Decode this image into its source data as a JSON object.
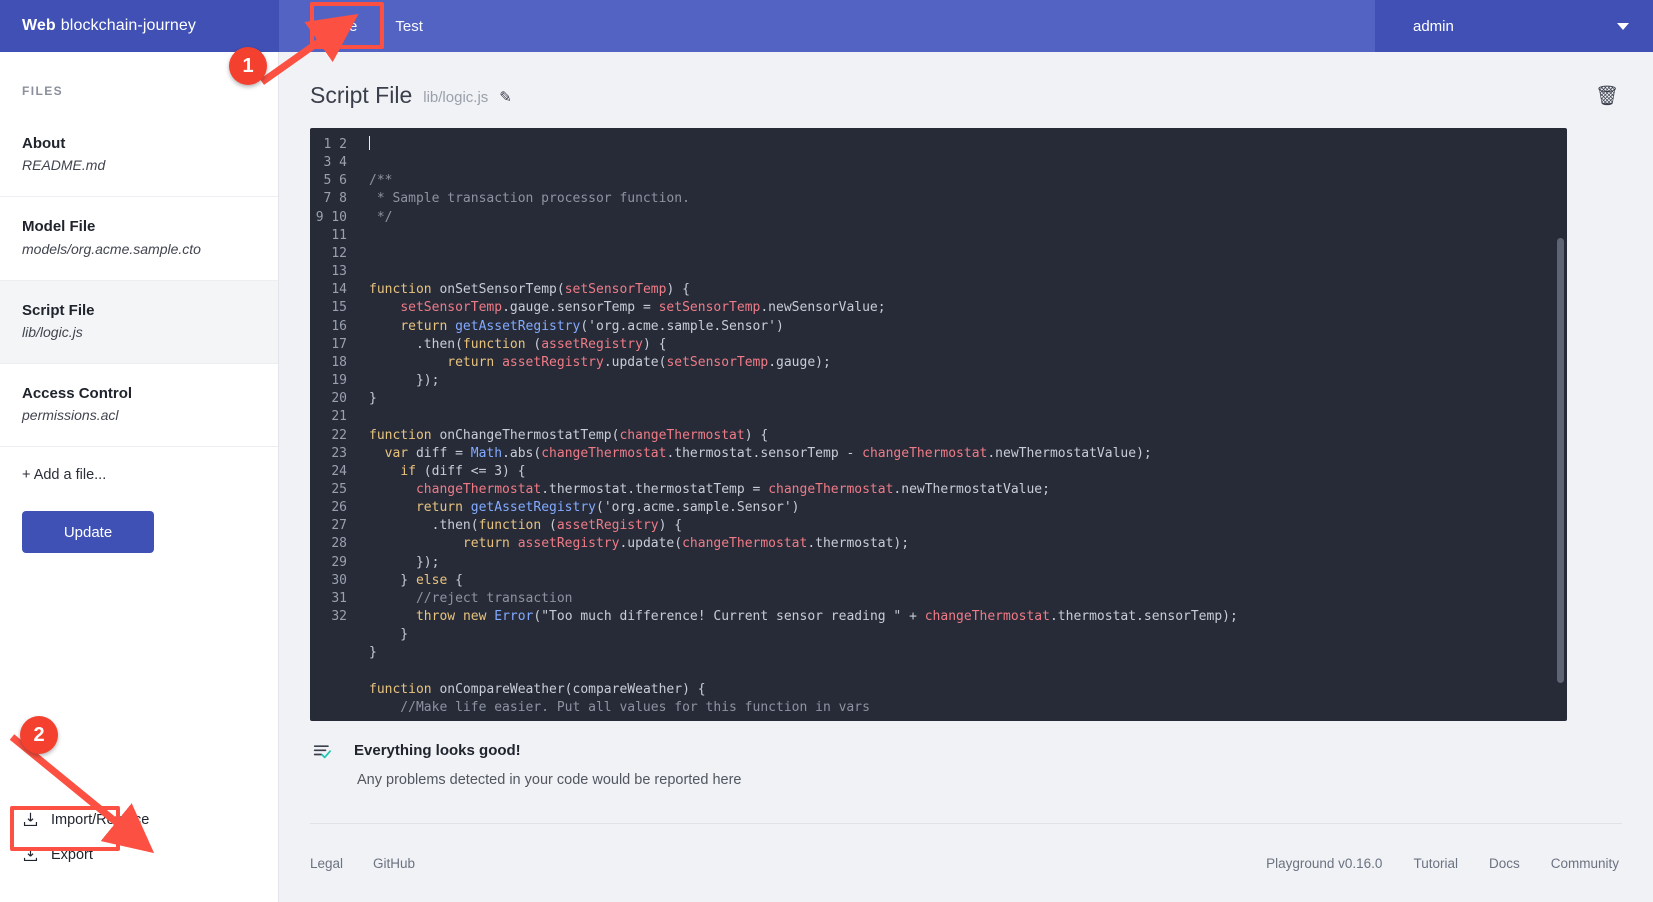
{
  "header": {
    "brand_bold": "Web",
    "brand_rest": "blockchain-journey",
    "tabs": [
      {
        "label": "Define",
        "active": true
      },
      {
        "label": "Test",
        "active": false
      }
    ],
    "user": "admin",
    "caret_icon": "chevron-down-icon",
    "bg_color": "#4050b5",
    "nav_bg_color": "#5263c3"
  },
  "sidebar": {
    "section_label": "FILES",
    "files": [
      {
        "title": "About",
        "path": "README.md",
        "selected": false
      },
      {
        "title": "Model File",
        "path": "models/org.acme.sample.cto",
        "selected": false
      },
      {
        "title": "Script File",
        "path": "lib/logic.js",
        "selected": true
      },
      {
        "title": "Access Control",
        "path": "permissions.acl",
        "selected": false
      }
    ],
    "add_file_label": "+ Add a file...",
    "update_label": "Update",
    "actions": [
      {
        "label": "Import/Replace",
        "icon": "import-icon"
      },
      {
        "label": "Export",
        "icon": "export-icon"
      }
    ]
  },
  "editor": {
    "title": "Script File",
    "file": "lib/logic.js",
    "edit_icon": "pencil-icon",
    "delete_icon": "trash-icon",
    "code_lines": [
      "",
      "",
      "/**",
      " * Sample transaction processor function.",
      " */",
      "",
      "",
      "",
      "function onSetSensorTemp(setSensorTemp) {",
      "    setSensorTemp.gauge.sensorTemp = setSensorTemp.newSensorValue;",
      "    return getAssetRegistry('org.acme.sample.Sensor')",
      "      .then(function (assetRegistry) {",
      "          return assetRegistry.update(setSensorTemp.gauge);",
      "      });",
      "}",
      "",
      "function onChangeThermostatTemp(changeThermostat) {",
      "  var diff = Math.abs(changeThermostat.thermostat.sensorTemp - changeThermostat.newThermostatValue);",
      "    if (diff <= 3) {",
      "      changeThermostat.thermostat.thermostatTemp = changeThermostat.newThermostatValue;",
      "      return getAssetRegistry('org.acme.sample.Sensor')",
      "        .then(function (assetRegistry) {",
      "            return assetRegistry.update(changeThermostat.thermostat);",
      "      });",
      "    } else {",
      "      //reject transaction",
      "      throw new Error(\"Too much difference! Current sensor reading \" + changeThermostat.thermostat.sensorTemp);",
      "    }",
      "}",
      "",
      "function onCompareWeather(compareWeather) {",
      "    //Make life easier. Put all values for this function in vars"
    ],
    "first_line_number": 1,
    "last_line_number": 32,
    "scrollbar": "vertical-scrollbar"
  },
  "status": {
    "icon": "check-list-icon",
    "title": "Everything looks good!",
    "subtitle": "Any problems detected in your code would be reported here"
  },
  "footer": {
    "left": [
      "Legal",
      "GitHub"
    ],
    "right": [
      "Playground v0.16.0",
      "Tutorial",
      "Docs",
      "Community"
    ]
  },
  "annotations": {
    "step1": "1",
    "step2": "2",
    "color": "#f4402f"
  }
}
